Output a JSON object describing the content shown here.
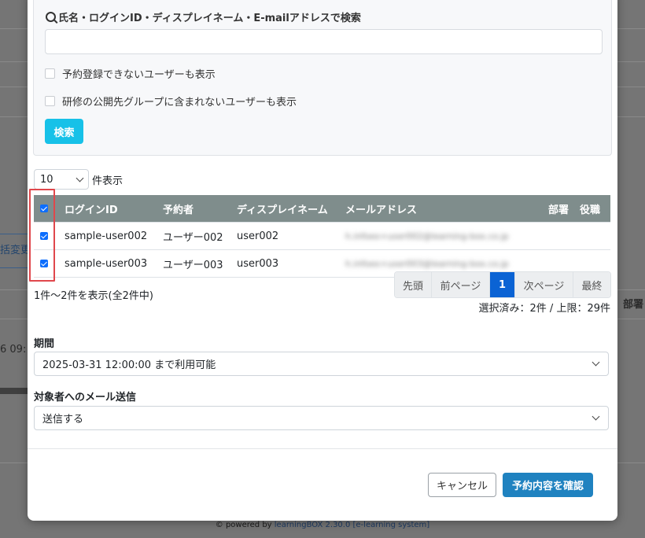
{
  "background": {
    "bulk_change_label": "括変更",
    "date_fragment": "6 09:",
    "dept_column": "部署",
    "footer_prefix": "© powered by",
    "footer_link": "learningBOX 2.30.0 [e-learning system]"
  },
  "search": {
    "label": "氏名・ログインID・ディスプレイネーム・E-mailアドレスで検索",
    "value": "",
    "checkbox_unreservable": "予約登録できないユーザーも表示",
    "checkbox_outside_group": "研修の公開先グループに含まれないユーザーも表示",
    "button_label": "検索"
  },
  "per_page": {
    "value": "10",
    "suffix": "件表示"
  },
  "table": {
    "columns": [
      "ログインID",
      "予約者",
      "ディスプレイネーム",
      "メールアドレス",
      "部署",
      "役職"
    ],
    "rows": [
      {
        "login_id": "sample-user002",
        "reserver": "ユーザー002",
        "display_name": "user002",
        "email": "h.infoex+user002@learning-box.co.jp",
        "dept": "",
        "role": "",
        "checked": true
      },
      {
        "login_id": "sample-user003",
        "reserver": "ユーザー003",
        "display_name": "user003",
        "email": "h.infoex+user003@learning-box.co.jp",
        "dept": "",
        "role": "",
        "checked": true
      }
    ]
  },
  "summary": "1件～2件を表示(全2件中)",
  "pagination": {
    "first": "先頭",
    "prev": "前ページ",
    "current": "1",
    "next": "次ページ",
    "last": "最終"
  },
  "selected_count": "選択済み：2件 / 上限：29件",
  "period": {
    "label": "期間",
    "value": "2025-03-31 12:00:00 まで利用可能"
  },
  "mail": {
    "label": "対象者へのメール送信",
    "value": "送信する"
  },
  "buttons": {
    "cancel": "キャンセル",
    "confirm": "予約内容を確認"
  },
  "colors": {
    "header_bg": "#7f8d8c",
    "search_button": "#17c1e8",
    "confirm_button": "#1f82c0",
    "active_page": "#0b63d4",
    "highlight": "#e0474c"
  }
}
